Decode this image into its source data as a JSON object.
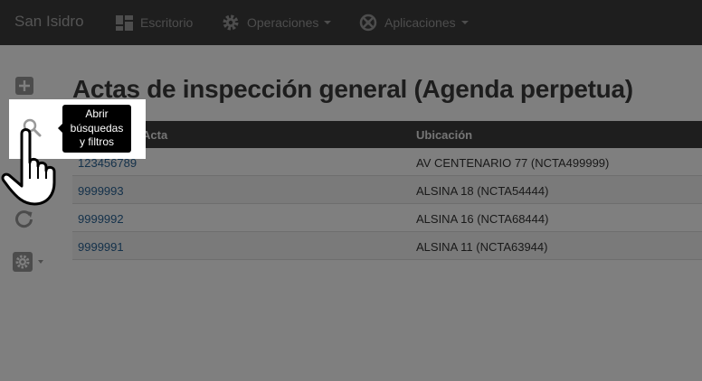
{
  "navbar": {
    "brand": "San Isidro",
    "items": [
      {
        "label": "Escritorio",
        "icon": "dashboard-icon"
      },
      {
        "label": "Operaciones",
        "icon": "gear-sync-icon"
      },
      {
        "label": "Aplicaciones",
        "icon": "apps-icon"
      }
    ]
  },
  "sidebar": {
    "buttons": [
      {
        "icon": "add-icon"
      },
      {
        "icon": "search-icon"
      },
      {
        "icon": "refresh-icon"
      },
      {
        "icon": "settings-icon"
      }
    ]
  },
  "page": {
    "title": "Actas de inspección general (Agenda perpetua)"
  },
  "table": {
    "headers": [
      "Número de Acta",
      "Ubicación"
    ],
    "rows": [
      {
        "acta": "123456789",
        "ubicacion": "AV CENTENARIO 77 (NCTA499999)"
      },
      {
        "acta": "9999993",
        "ubicacion": "ALSINA 18 (NCTA54444)"
      },
      {
        "acta": "9999992",
        "ubicacion": "ALSINA 16 (NCTA68444)"
      },
      {
        "acta": "9999991",
        "ubicacion": "ALSINA 11 (NCTA63944)"
      }
    ]
  },
  "tooltip": {
    "lines": [
      "Abrir",
      "búsquedas",
      "y filtros"
    ]
  },
  "colors": {
    "navbar": "#3c3c3c",
    "link": "#2a6496",
    "table_header": "#3d3d3d",
    "overlay": "rgba(0,0,0,0.5)"
  }
}
